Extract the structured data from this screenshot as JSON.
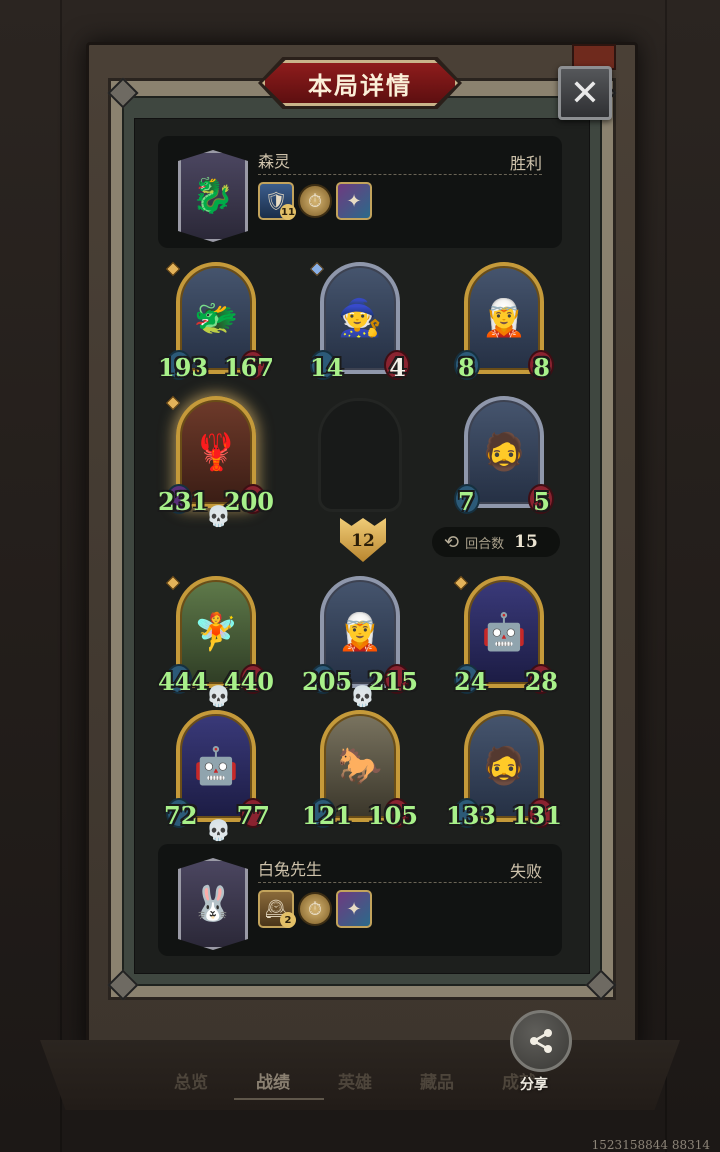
{
  "title": "本局详情",
  "close_symbol": "✕",
  "top_player": {
    "name": "森灵",
    "result": "胜利",
    "avatar_icon": "dragon-portrait",
    "items": [
      {
        "icon": "hero-card",
        "level": "11"
      },
      {
        "icon": "pocket-watch-token",
        "level": ""
      },
      {
        "icon": "spell-card",
        "level": ""
      }
    ]
  },
  "board": {
    "row1": [
      {
        "name": "blue-dragon",
        "atk": "193",
        "hp": "167",
        "skull": false
      },
      {
        "name": "witch",
        "atk": "14",
        "hp": "4",
        "skull": false
      },
      {
        "name": "sorceress",
        "atk": "8",
        "hp": "8",
        "skull": false
      }
    ],
    "row2": [
      {
        "name": "red-dragon",
        "atk": "231",
        "hp": "200",
        "skull": true
      },
      {
        "name": "empty",
        "atk": "",
        "hp": "",
        "skull": false
      },
      {
        "name": "old-king",
        "atk": "7",
        "hp": "5",
        "skull": false
      }
    ],
    "turn_badge": "12",
    "rounds_label": "回合数",
    "rounds_value": "15",
    "row3": [
      {
        "name": "forest-elf",
        "atk": "444",
        "hp": "440",
        "skull": true
      },
      {
        "name": "night-elf",
        "atk": "205",
        "hp": "215",
        "skull": true
      },
      {
        "name": "mech-golem",
        "atk": "24",
        "hp": "28",
        "skull": false
      }
    ],
    "row4": [
      {
        "name": "mech-golem",
        "atk": "72",
        "hp": "77",
        "skull": true
      },
      {
        "name": "knights",
        "atk": "121",
        "hp": "105",
        "skull": false
      },
      {
        "name": "old-king",
        "atk": "133",
        "hp": "131",
        "skull": false
      }
    ]
  },
  "bottom_player": {
    "name": "白兔先生",
    "result": "失败",
    "avatar_icon": "rabbit-portrait",
    "items": [
      {
        "icon": "hero-card",
        "level": "2"
      },
      {
        "icon": "pocket-watch-token",
        "level": ""
      },
      {
        "icon": "spell-card",
        "level": ""
      }
    ]
  },
  "tabs": [
    "总览",
    "战绩",
    "英雄",
    "藏品",
    "成就"
  ],
  "active_tab": "战绩",
  "share_label": "分享",
  "footer_id": "1523158844 88314"
}
